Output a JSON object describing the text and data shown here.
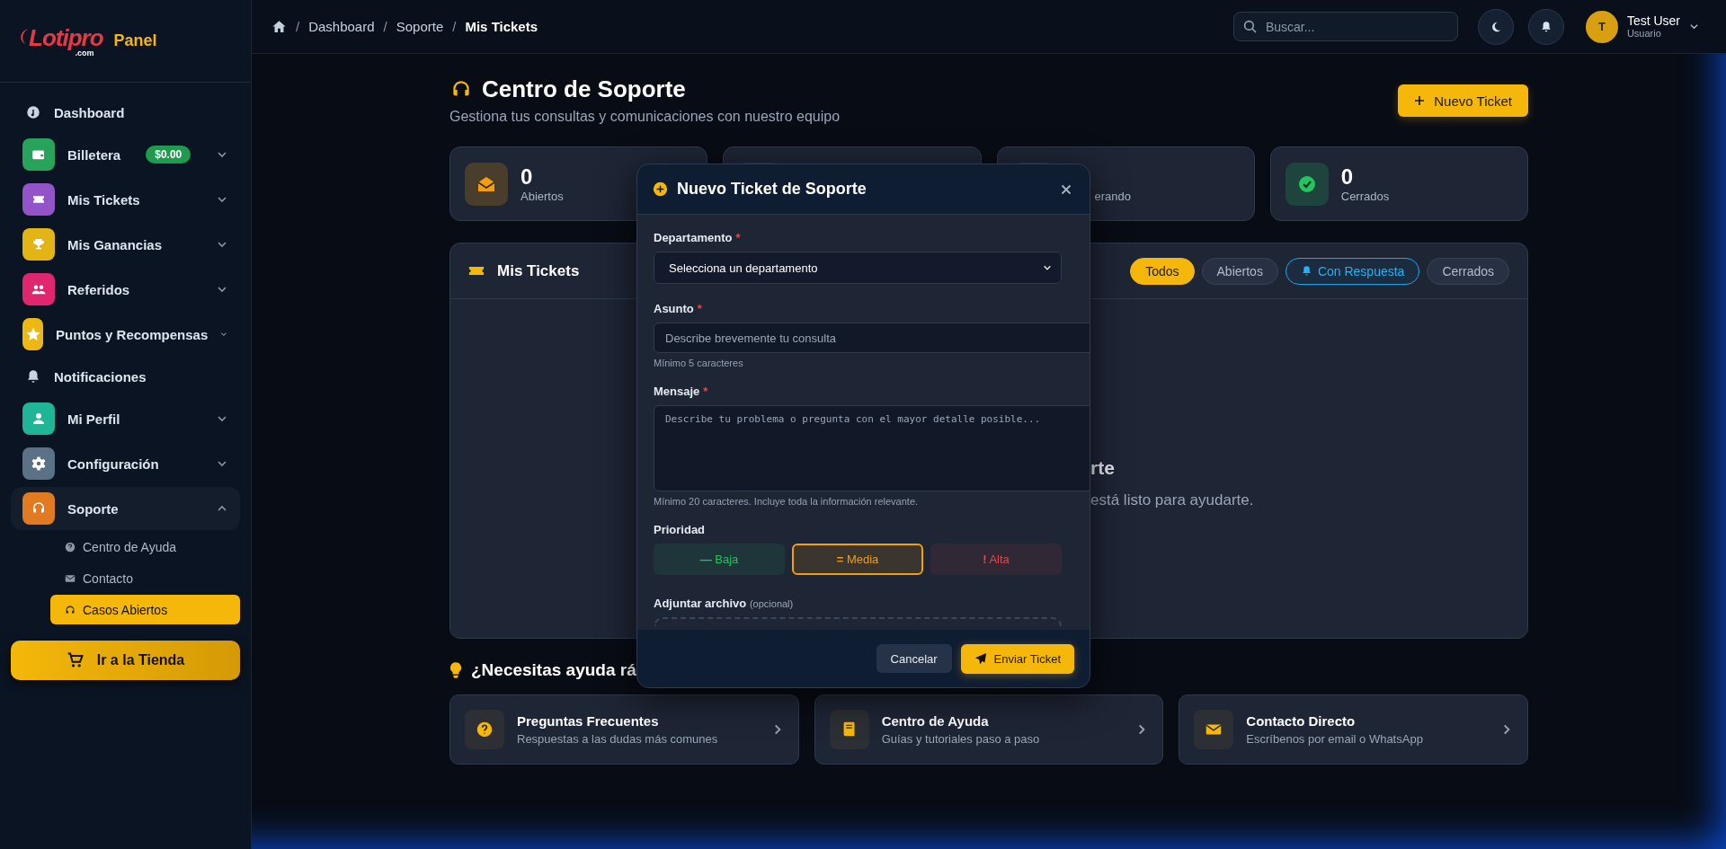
{
  "brand": {
    "name": "Lotipro",
    "suffix": ".com",
    "panel": "Panel"
  },
  "sidebar": {
    "items": [
      {
        "label": "Dashboard",
        "kind": "link"
      },
      {
        "label": "Billetera",
        "kind": "group",
        "color": "#27a35c",
        "badge": "$0.00",
        "expanded": false
      },
      {
        "label": "Mis Tickets",
        "kind": "group",
        "color": "#9254c8",
        "expanded": false
      },
      {
        "label": "Mis Ganancias",
        "kind": "group",
        "color": "#e2b514",
        "expanded": false
      },
      {
        "label": "Referidos",
        "kind": "group",
        "color": "#e0266e",
        "expanded": false
      },
      {
        "label": "Puntos y Recompensas",
        "kind": "group",
        "color": "#edb812",
        "expanded": false
      },
      {
        "label": "Notificaciones",
        "kind": "link"
      },
      {
        "label": "Mi Perfil",
        "kind": "group",
        "color": "#1fb597",
        "expanded": false
      },
      {
        "label": "Configuración",
        "kind": "group",
        "color": "#5b7186",
        "expanded": false
      },
      {
        "label": "Soporte",
        "kind": "group",
        "color": "#e07b22",
        "expanded": true,
        "children": [
          {
            "label": "Centro de Ayuda",
            "selected": false
          },
          {
            "label": "Contacto",
            "selected": false
          },
          {
            "label": "Casos Abiertos",
            "selected": true
          }
        ]
      }
    ],
    "shop_button": "Ir a la Tienda"
  },
  "breadcrumb": {
    "separator": "/",
    "items": [
      "Dashboard",
      "Soporte",
      "Mis Tickets"
    ]
  },
  "search": {
    "placeholder": "Buscar..."
  },
  "user": {
    "initial": "T",
    "name": "Test User",
    "role": "Usuario"
  },
  "header": {
    "title": "Centro de Soporte",
    "subtitle": "Gestiona tus consultas y comunicaciones con nuestro equipo",
    "new_button": "Nuevo Ticket"
  },
  "stats": [
    {
      "kind": "full",
      "value": "0",
      "label": "Abiertos",
      "color": "#f59e0b"
    },
    {
      "kind": "covered"
    },
    {
      "kind": "covered",
      "label": "erando"
    },
    {
      "kind": "full",
      "value": "0",
      "label": "Cerrados",
      "color": "#22c55e"
    }
  ],
  "tickets": {
    "title": "Mis Tickets",
    "filters": [
      {
        "label": "Todos",
        "selected": true,
        "alert": false
      },
      {
        "label": "Abiertos",
        "selected": false,
        "alert": false
      },
      {
        "label": "Con Respuesta",
        "selected": false,
        "alert": true
      },
      {
        "label": "Cerrados",
        "selected": false,
        "alert": false
      }
    ],
    "empty_title": "rte",
    "empty_text": "está listo para ayudarte."
  },
  "help": {
    "title": "¿Necesitas ayuda rá",
    "cards": [
      {
        "title": "Preguntas Frecuentes",
        "text": "Respuestas a las dudas más comunes"
      },
      {
        "title": "Centro de Ayuda",
        "text": "Guías y tutoriales paso a paso"
      },
      {
        "title": "Contacto Directo",
        "text": "Escríbenos por email o WhatsApp"
      }
    ]
  },
  "modal": {
    "title": "Nuevo Ticket de Soporte",
    "department": {
      "label": "Departamento",
      "required": "*",
      "value": "Selecciona un departamento"
    },
    "subject": {
      "label": "Asunto",
      "required": "*",
      "placeholder": "Describe brevemente tu consulta",
      "hint": "Mínimo 5 caracteres"
    },
    "message": {
      "label": "Mensaje",
      "required": "*",
      "placeholder": "Describe tu problema o pregunta con el mayor detalle posible...",
      "hint": "Mínimo 20 caracteres. Incluye toda la información relevante."
    },
    "priority": {
      "label": "Prioridad",
      "options": [
        {
          "symbol": "—",
          "label": "Baja",
          "color": "#22c55e",
          "selected": false
        },
        {
          "symbol": "=",
          "label": "Media",
          "color": "#f59e0b",
          "selected": true
        },
        {
          "symbol": "!",
          "label": "Alta",
          "color": "#ef4444",
          "selected": false
        }
      ]
    },
    "attachment": {
      "label": "Adjuntar archivo",
      "note": "(opcional)"
    },
    "cancel": "Cancelar",
    "submit": "Enviar Ticket"
  }
}
